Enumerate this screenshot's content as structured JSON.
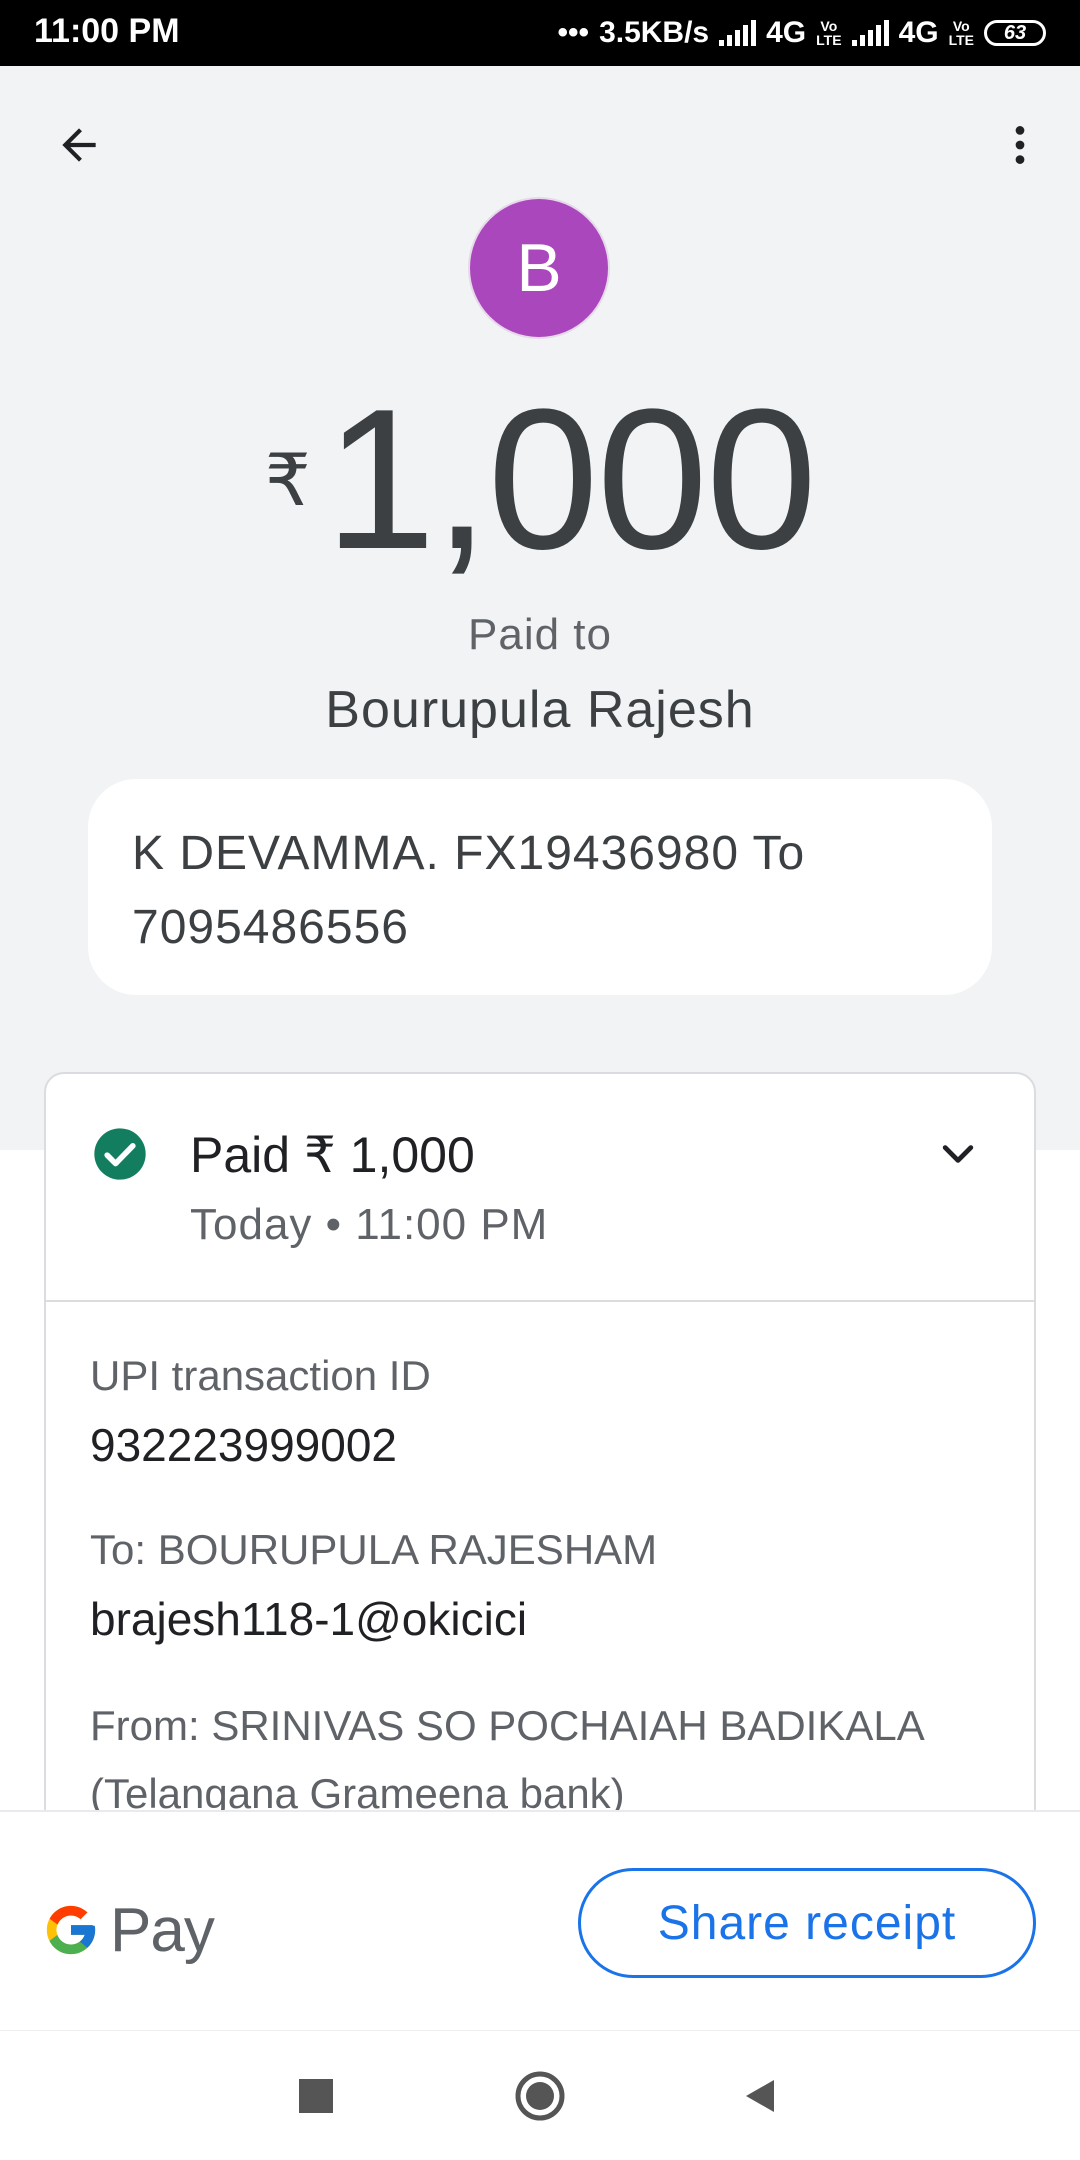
{
  "status_bar": {
    "time": "11:00 PM",
    "network_speed": "3.5KB/s",
    "network_type_1": "4G",
    "network_type_2": "4G",
    "volte_top": "Vo",
    "volte_bottom": "LTE",
    "battery": "63"
  },
  "header": {
    "back_icon": "arrow-back-icon",
    "menu_icon": "more-vert-icon"
  },
  "payment": {
    "avatar_initial": "B",
    "avatar_color": "#ab47bc",
    "currency_symbol": "₹",
    "amount": "1,000",
    "paid_to_label": "Paid to",
    "payee_name": "Bourupula Rajesh",
    "note_line1": "K DEVAMMA. FX19436980 To",
    "note_line2": "7095486556"
  },
  "transaction": {
    "status": "Paid ₹ 1,000",
    "time": "Today • 11:00 PM",
    "status_icon": "check-circle-icon",
    "status_color": "#137e5f",
    "expand_icon": "chevron-down-icon",
    "upi_label": "UPI transaction ID",
    "upi_value": "932223999002",
    "to_label": "To: BOURUPULA RAJESHAM",
    "to_value": "brajesh118-1@okicici",
    "from_label": "From: SRINIVAS SO POCHAIAH BADIKALA",
    "from_bank": "(Telangana Grameena bank)"
  },
  "bottom_bar": {
    "logo_text": "Pay",
    "share_label": "Share receipt",
    "accent_color": "#1a73e8"
  },
  "nav_bar": {
    "recent_icon": "square-icon",
    "home_icon": "circle-icon",
    "back_icon": "triangle-back-icon"
  }
}
